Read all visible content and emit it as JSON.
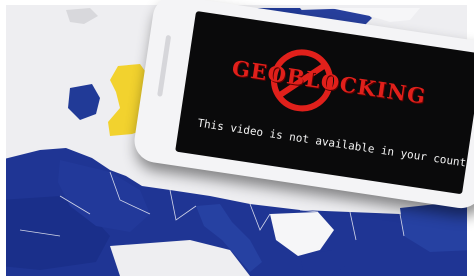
{
  "image": {
    "kind": "photo",
    "subject": "smartphone lying on a map of Europe"
  },
  "screen": {
    "title": "GEOBLOCKING",
    "message": "This video is not available in your country.",
    "title_color": "#e0201b",
    "background_color": "#0a0a0b"
  },
  "map": {
    "sea_color": "#f1f1f3",
    "eu_color": "#1f3594",
    "highlight_color": "#f2d22e",
    "non_eu_color": "#f6f6f8"
  },
  "icons": {
    "prohibition": "no-entry-sign-icon"
  }
}
